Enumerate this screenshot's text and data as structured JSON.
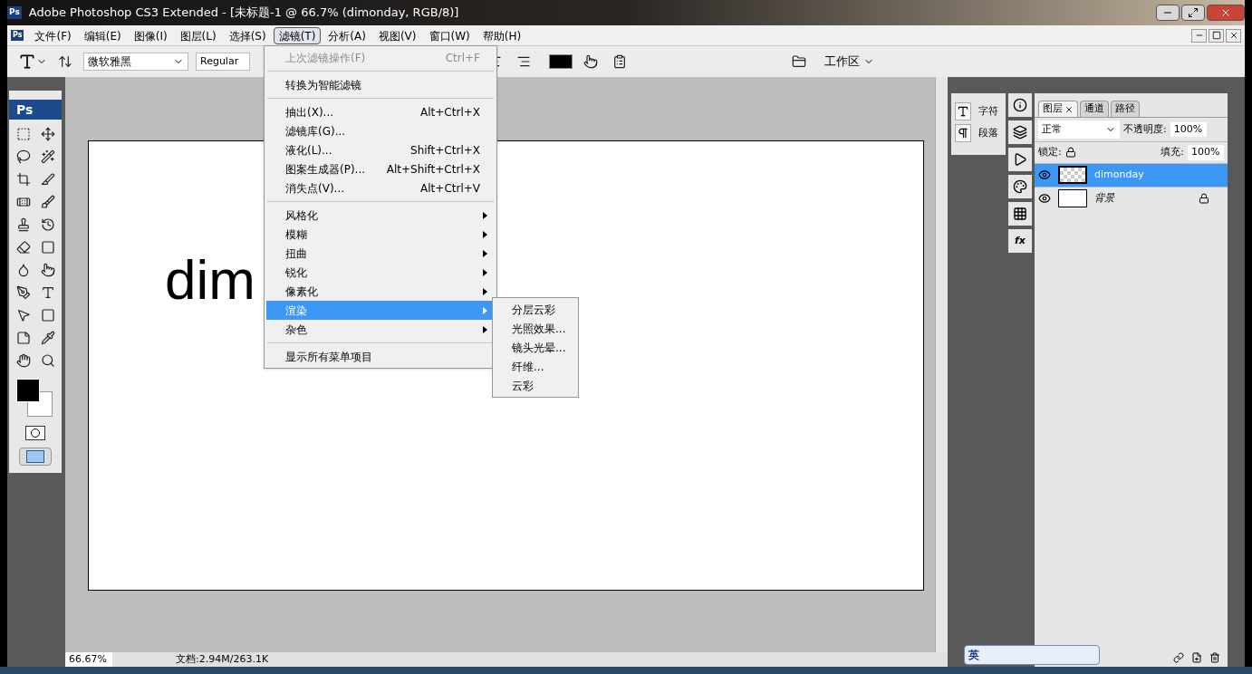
{
  "window": {
    "app_icon": "Ps",
    "menu_icon": "Ps",
    "title": "Adobe Photoshop CS3 Extended - [未标题-1 @ 66.7% (dimonday, RGB/8)]"
  },
  "menu_bar": [
    {
      "label": "文件(F)",
      "selected": false
    },
    {
      "label": "编辑(E)",
      "selected": false
    },
    {
      "label": "图像(I)",
      "selected": false
    },
    {
      "label": "图层(L)",
      "selected": false
    },
    {
      "label": "选择(S)",
      "selected": false
    },
    {
      "label": "滤镜(T)",
      "selected": true
    },
    {
      "label": "分析(A)",
      "selected": false
    },
    {
      "label": "视图(V)",
      "selected": false
    },
    {
      "label": "窗口(W)",
      "selected": false
    },
    {
      "label": "帮助(H)",
      "selected": false
    }
  ],
  "options_bar": {
    "font_family": "微软雅黑",
    "font_style": "Regular",
    "workspace": "工作区"
  },
  "toolbox": {
    "logo": "Ps"
  },
  "canvas": {
    "text": "dim"
  },
  "filter_menu": [
    {
      "kind": "item",
      "label": "上次滤镜操作(F)",
      "shortcut": "Ctrl+F",
      "disabled": true,
      "selected": false,
      "submenu": false
    },
    {
      "kind": "separator"
    },
    {
      "kind": "item",
      "label": "转换为智能滤镜",
      "disabled": false,
      "selected": false,
      "submenu": false
    },
    {
      "kind": "separator"
    },
    {
      "kind": "item",
      "label": "抽出(X)...",
      "shortcut": "Alt+Ctrl+X",
      "disabled": false,
      "selected": false,
      "submenu": false
    },
    {
      "kind": "item",
      "label": "滤镜库(G)...",
      "disabled": false,
      "selected": false,
      "submenu": false
    },
    {
      "kind": "item",
      "label": "液化(L)...",
      "shortcut": "Shift+Ctrl+X",
      "disabled": false,
      "selected": false,
      "submenu": false
    },
    {
      "kind": "item",
      "label": "图案生成器(P)...",
      "shortcut": "Alt+Shift+Ctrl+X",
      "disabled": false,
      "selected": false,
      "submenu": false
    },
    {
      "kind": "item",
      "label": "消失点(V)...",
      "shortcut": "Alt+Ctrl+V",
      "disabled": false,
      "selected": false,
      "submenu": false
    },
    {
      "kind": "separator"
    },
    {
      "kind": "item",
      "label": "风格化",
      "disabled": false,
      "selected": false,
      "submenu": true
    },
    {
      "kind": "item",
      "label": "模糊",
      "disabled": false,
      "selected": false,
      "submenu": true
    },
    {
      "kind": "item",
      "label": "扭曲",
      "disabled": false,
      "selected": false,
      "submenu": true
    },
    {
      "kind": "item",
      "label": "锐化",
      "disabled": false,
      "selected": false,
      "submenu": true
    },
    {
      "kind": "item",
      "label": "像素化",
      "disabled": false,
      "selected": false,
      "submenu": true
    },
    {
      "kind": "item",
      "label": "渲染",
      "disabled": false,
      "selected": true,
      "submenu": true
    },
    {
      "kind": "item",
      "label": "杂色",
      "disabled": false,
      "selected": false,
      "submenu": true
    },
    {
      "kind": "separator"
    },
    {
      "kind": "item",
      "label": "显示所有菜单项目",
      "disabled": false,
      "selected": false,
      "submenu": false
    }
  ],
  "render_submenu": [
    "分层云彩",
    "光照效果...",
    "镜头光晕...",
    "纤维...",
    "云彩"
  ],
  "text_panels": [
    {
      "kind": "character",
      "label": "字符"
    },
    {
      "kind": "paragraph",
      "label": "段落"
    }
  ],
  "styles_icon": "fx",
  "layers_panel": {
    "tabs": [
      {
        "label": "图层",
        "selected": true,
        "closable": true
      },
      {
        "label": "通道",
        "selected": false,
        "closable": false
      },
      {
        "label": "路径",
        "selected": false,
        "closable": false
      }
    ],
    "blend_mode": "正常",
    "opacity_label": "不透明度:",
    "opacity": "100%",
    "lock_label": "锁定:",
    "fill_label": "填充:",
    "fill": "100%",
    "layers": [
      {
        "name": "dimonday",
        "selected": true,
        "visible": true,
        "locked": false,
        "kind": "transparent"
      },
      {
        "name": "背景",
        "selected": false,
        "visible": true,
        "locked": true,
        "kind": "background"
      }
    ]
  },
  "status_bar": {
    "zoom": "66.67%",
    "doc_info": "文档:2.94M/263.1K"
  },
  "ime_bar": {
    "language": "英"
  }
}
